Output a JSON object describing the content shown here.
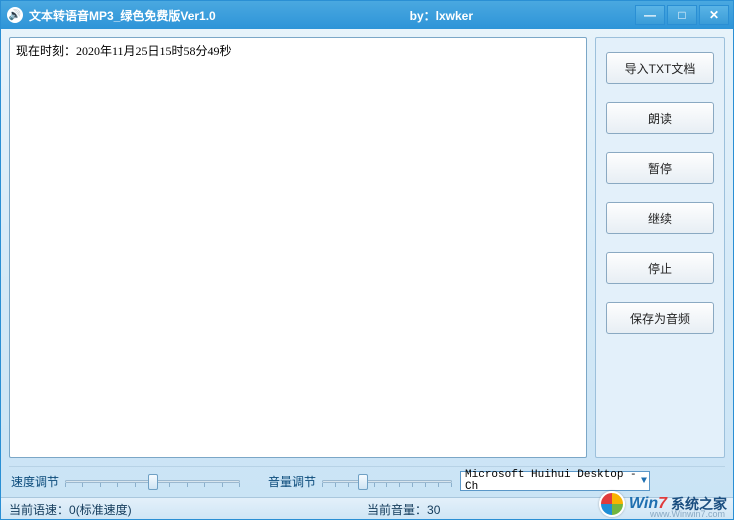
{
  "titlebar": {
    "icon_glyph": "🔊",
    "title": "文本转语音MP3_绿色免费版Ver1.0",
    "author_prefix": "by：",
    "author": "lxwker"
  },
  "win_controls": {
    "minimize": "—",
    "maximize": "□",
    "close": "✕"
  },
  "textarea": {
    "value": "现在时刻：2020年11月25日15时58分49秒"
  },
  "buttons": {
    "import_txt": "导入TXT文档",
    "read": "朗读",
    "pause": "暂停",
    "resume": "继续",
    "stop": "停止",
    "save_audio": "保存为音频"
  },
  "sliders": {
    "speed_label": "速度调节",
    "speed_value": 0,
    "speed_min": -10,
    "speed_max": 10,
    "volume_label": "音量调节",
    "volume_value": 30,
    "volume_min": 0,
    "volume_max": 100
  },
  "voice_select": {
    "selected": "Microsoft Huihui Desktop - Ch"
  },
  "status": {
    "speed_label": "当前语速：",
    "speed_text": "0(标准速度)",
    "volume_label": "当前音量：",
    "volume_text": "30"
  },
  "watermark": {
    "brand_left": "Win",
    "brand_num": "7",
    "brand_right": "系统之家",
    "url": "www.Winwin7.com"
  }
}
